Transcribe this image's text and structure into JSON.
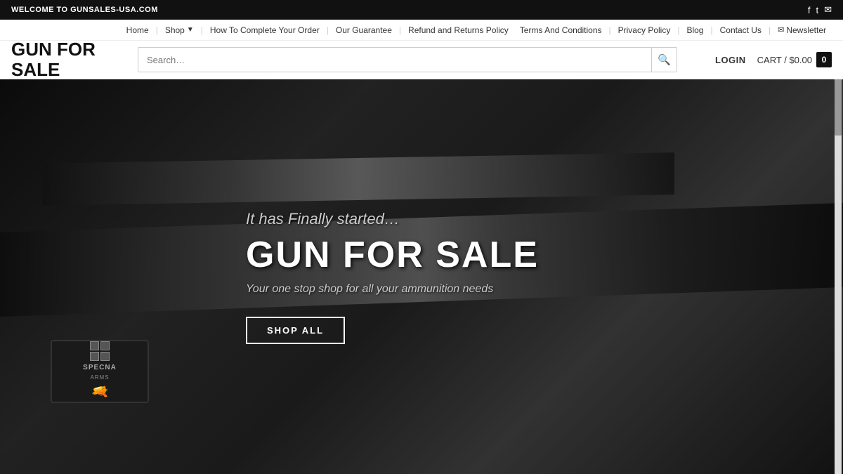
{
  "topbar": {
    "welcome_text": "WELCOME TO GUNSALES-USA.COM",
    "social_icons": [
      "facebook",
      "twitter",
      "email"
    ]
  },
  "nav": {
    "items": [
      {
        "label": "Home",
        "id": "home"
      },
      {
        "label": "Shop",
        "id": "shop",
        "has_dropdown": true
      },
      {
        "label": "How To Complete Your Order",
        "id": "how-to"
      },
      {
        "label": "Our Guarantee",
        "id": "guarantee"
      },
      {
        "label": "Refund and Returns Policy",
        "id": "refund"
      },
      {
        "label": "Terms And Conditions",
        "id": "terms"
      },
      {
        "label": "Privacy Policy",
        "id": "privacy"
      },
      {
        "label": "Blog",
        "id": "blog"
      },
      {
        "label": "Contact Us",
        "id": "contact"
      },
      {
        "label": "Newsletter",
        "id": "newsletter"
      }
    ]
  },
  "header": {
    "logo_line1": "GUN FOR",
    "logo_line2": "SALE",
    "search_placeholder": "Search…",
    "login_label": "LOGIN",
    "cart_label": "CART /",
    "cart_amount": "$0.00",
    "cart_count": "0"
  },
  "hero": {
    "tagline": "It has Finally started…",
    "title": "GUN FOR SALE",
    "subtitle": "Your one stop shop for all your ammunition needs",
    "cta_label": "SHOP ALL",
    "patch_brand": "SPECNA",
    "patch_brand2": "ARMS"
  }
}
